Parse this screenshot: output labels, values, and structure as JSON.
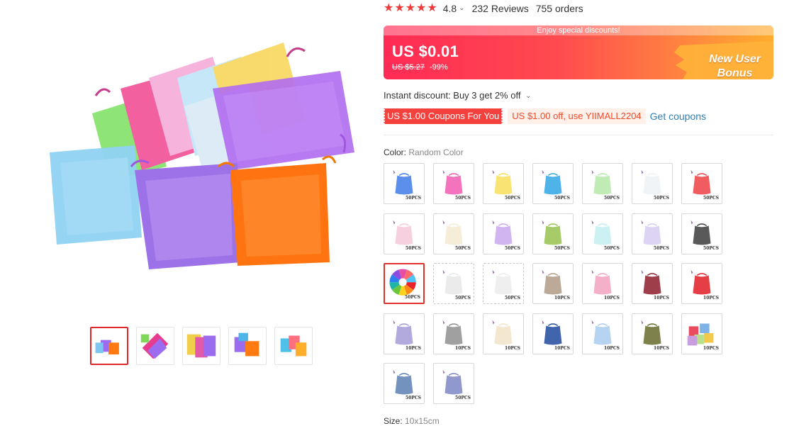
{
  "rating": {
    "stars": 5,
    "value": "4.8",
    "reviews": "232 Reviews",
    "orders": "755 orders"
  },
  "price": {
    "banner_note": "Enjoy special discounts!",
    "current": "US $0.01",
    "original": "US $5.27",
    "discount": "-99%",
    "bonus_line1": "New User",
    "bonus_line2": "Bonus"
  },
  "instant_discount": "Instant discount: Buy 3 get 2% off",
  "coupons": {
    "store_coupon": "US $1.00 Coupons For You",
    "code_coupon": "US $1.00 off, use YIIMALL2204",
    "get_link": "Get coupons"
  },
  "color": {
    "label": "Color:",
    "value": "Random Color"
  },
  "size": {
    "label": "Size:",
    "value": "10x15cm"
  },
  "thumbnails": [
    {
      "colors": [
        "#9b6cf0",
        "#ff7b12",
        "#7cc6ef"
      ]
    },
    {
      "colors": [
        "#e63b8f",
        "#9b6cf0",
        "#7fd85a"
      ]
    },
    {
      "colors": [
        "#f0d04a",
        "#e25aa8",
        "#9b6cf0"
      ]
    },
    {
      "colors": [
        "#9b6cf0",
        "#ff7b12",
        "#4fb5e8"
      ]
    },
    {
      "colors": [
        "#4fc0e8",
        "#ff6f7f",
        "#ffae2a"
      ]
    }
  ],
  "swatches": [
    {
      "color": "#3f7be8",
      "qty": "50PCS"
    },
    {
      "color": "#f15ab2",
      "qty": "50PCS"
    },
    {
      "color": "#f7de5a",
      "qty": "50PCS"
    },
    {
      "color": "#2fa6e5",
      "qty": "50PCS"
    },
    {
      "color": "#b6e8a8",
      "qty": "50PCS"
    },
    {
      "color": "#eef2f6",
      "qty": "50PCS"
    },
    {
      "color": "#ef3f45",
      "qty": "50PCS"
    },
    {
      "color": "#f6c8da",
      "qty": "50PCS"
    },
    {
      "color": "#f3ead0",
      "qty": "50PCS"
    },
    {
      "color": "#c9a8ee",
      "qty": "50PCS"
    },
    {
      "color": "#98c24e",
      "qty": "50PCS"
    },
    {
      "color": "#c2eef0",
      "qty": "50PCS"
    },
    {
      "color": "#d7cdf2",
      "qty": "50PCS"
    },
    {
      "color": "#3c3c3c",
      "qty": "50PCS"
    },
    {
      "color": "rainbow",
      "qty": "50PCS"
    },
    {
      "color": "#e8e8e8",
      "qty": "50PCS"
    },
    {
      "color": "#ececec",
      "qty": "50PCS"
    },
    {
      "color": "#b09a85",
      "qty": "10PCS"
    },
    {
      "color": "#f2a2be",
      "qty": "10PCS"
    },
    {
      "color": "#8c1c2a",
      "qty": "10PCS"
    },
    {
      "color": "#e01c24",
      "qty": "10PCS"
    },
    {
      "color": "#a59ad6",
      "qty": "10PCS"
    },
    {
      "color": "#8f8f8f",
      "qty": "10PCS"
    },
    {
      "color": "#f2e3c8",
      "qty": "10PCS"
    },
    {
      "color": "#1f4a9e",
      "qty": "10PCS"
    },
    {
      "color": "#a9cbee",
      "qty": "10PCS"
    },
    {
      "color": "#676b2c",
      "qty": "10PCS"
    },
    {
      "color": "mixed",
      "qty": "10PCS"
    },
    {
      "color": "#5a7fb3",
      "qty": "50PCS"
    },
    {
      "color": "#7d86c4",
      "qty": "50PCS"
    }
  ],
  "theme": {
    "accent": "#e0312c",
    "link": "#2f7fb5",
    "star": "#f03a3a"
  }
}
